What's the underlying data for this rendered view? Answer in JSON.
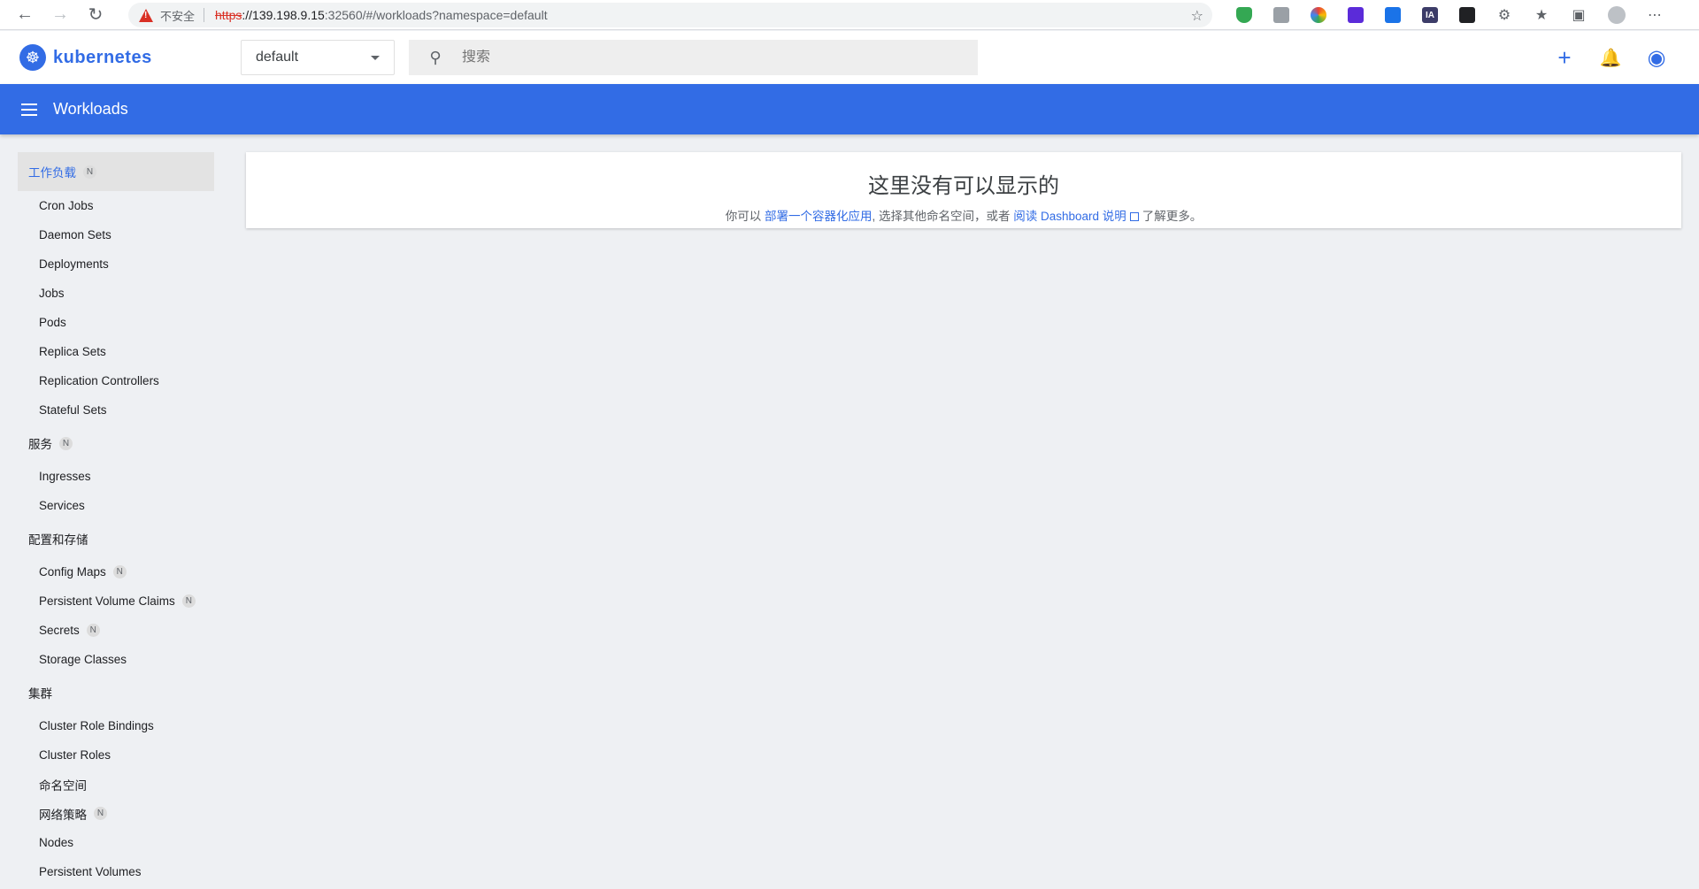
{
  "browser": {
    "security_label": "不安全",
    "url_scheme": "https",
    "url_host": "://139.198.9.15",
    "url_rest": ":32560/#/workloads?namespace=default",
    "extension_ia_label": "IA"
  },
  "header": {
    "logo_text": "kubernetes",
    "namespace": "default",
    "search_placeholder": "搜索"
  },
  "toolbar": {
    "title": "Workloads"
  },
  "sidebar": {
    "workloads": {
      "label": "工作负载",
      "badge": "N"
    },
    "workload_items": [
      "Cron Jobs",
      "Daemon Sets",
      "Deployments",
      "Jobs",
      "Pods",
      "Replica Sets",
      "Replication Controllers",
      "Stateful Sets"
    ],
    "services": {
      "label": "服务",
      "badge": "N"
    },
    "service_items": [
      "Ingresses",
      "Services"
    ],
    "config": {
      "label": "配置和存储"
    },
    "config_items": [
      {
        "label": "Config Maps",
        "badge": "N"
      },
      {
        "label": "Persistent Volume Claims",
        "badge": "N"
      },
      {
        "label": "Secrets",
        "badge": "N"
      },
      {
        "label": "Storage Classes"
      }
    ],
    "cluster": {
      "label": "集群"
    },
    "cluster_items": [
      {
        "label": "Cluster Role Bindings"
      },
      {
        "label": "Cluster Roles"
      },
      {
        "label": "命名空间"
      },
      {
        "label": "网络策略",
        "badge": "N"
      },
      {
        "label": "Nodes"
      },
      {
        "label": "Persistent Volumes"
      }
    ]
  },
  "main": {
    "empty_title": "这里没有可以显示的",
    "text_prefix": "你可以",
    "deploy_link": "部署一个容器化应用",
    "text_middle": ", 选择其他命名空间，或者",
    "docs_link": "阅读 Dashboard 说明",
    "text_suffix": "了解更多。"
  }
}
